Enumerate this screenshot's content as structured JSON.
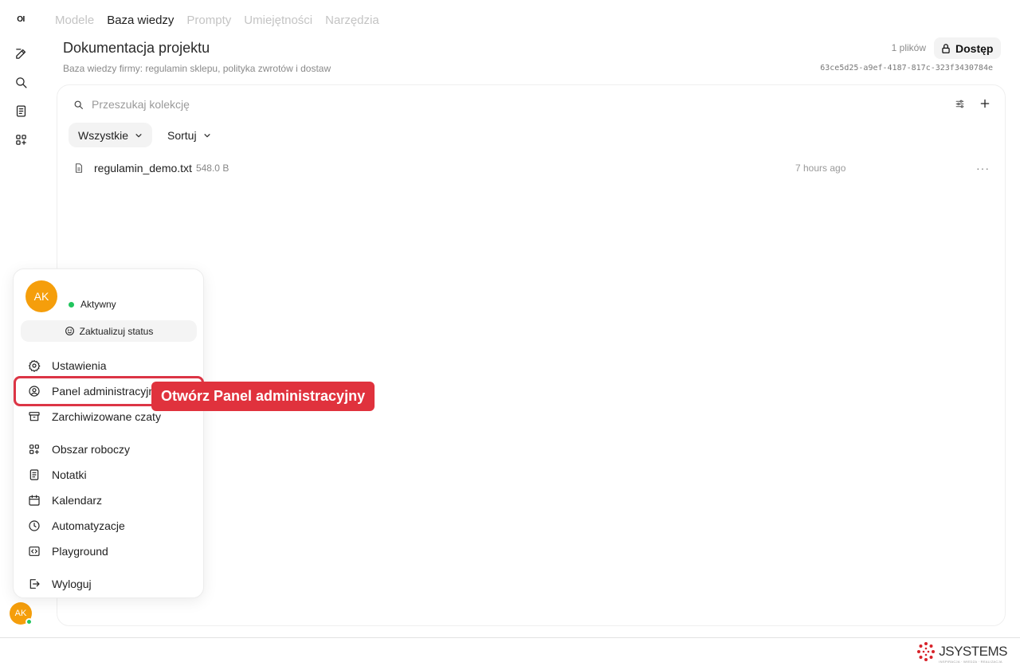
{
  "rail": {
    "logo": "OI",
    "avatar_initials": "AK"
  },
  "tabs": [
    {
      "label": "Modele",
      "active": false
    },
    {
      "label": "Baza wiedzy",
      "active": true
    },
    {
      "label": "Prompty",
      "active": false
    },
    {
      "label": "Umiejętności",
      "active": false
    },
    {
      "label": "Narzędzia",
      "active": false
    }
  ],
  "header": {
    "title": "Dokumentacja projektu",
    "subtitle": "Baza wiedzy firmy: regulamin sklepu, polityka zwrotów i dostaw",
    "files_count": "1 plików",
    "access_label": "Dostęp",
    "collection_id": "63ce5d25-a9ef-4187-817c-323f3430784e"
  },
  "collection": {
    "search_placeholder": "Przeszukaj kolekcję",
    "filter_label": "Wszystkie",
    "sort_label": "Sortuj",
    "files": [
      {
        "name": "regulamin_demo.txt",
        "size": "548.0 B",
        "modified": "7 hours ago",
        "more": "···"
      }
    ]
  },
  "user_menu": {
    "initials": "AK",
    "status": "Aktywny",
    "update_status_label": "Zaktualizuj status",
    "items": {
      "settings": "Ustawienia",
      "admin_panel": "Panel administracyjny",
      "archived": "Zarchiwizowane czaty",
      "workspace": "Obszar roboczy",
      "notes": "Notatki",
      "calendar": "Kalendarz",
      "automations": "Automatyzacje",
      "playground": "Playground",
      "logout": "Wyloguj"
    }
  },
  "annotation": {
    "callout": "Otwórz Panel administracyjny",
    "color": "#e0323d"
  },
  "brand": {
    "name": "JSYSTEMS",
    "tagline": "INSPIRACJA · WIEDZA · REALIZACJA"
  },
  "colors": {
    "avatar": "#f59e0b",
    "online": "#22c55e",
    "highlight": "#dc3545"
  }
}
